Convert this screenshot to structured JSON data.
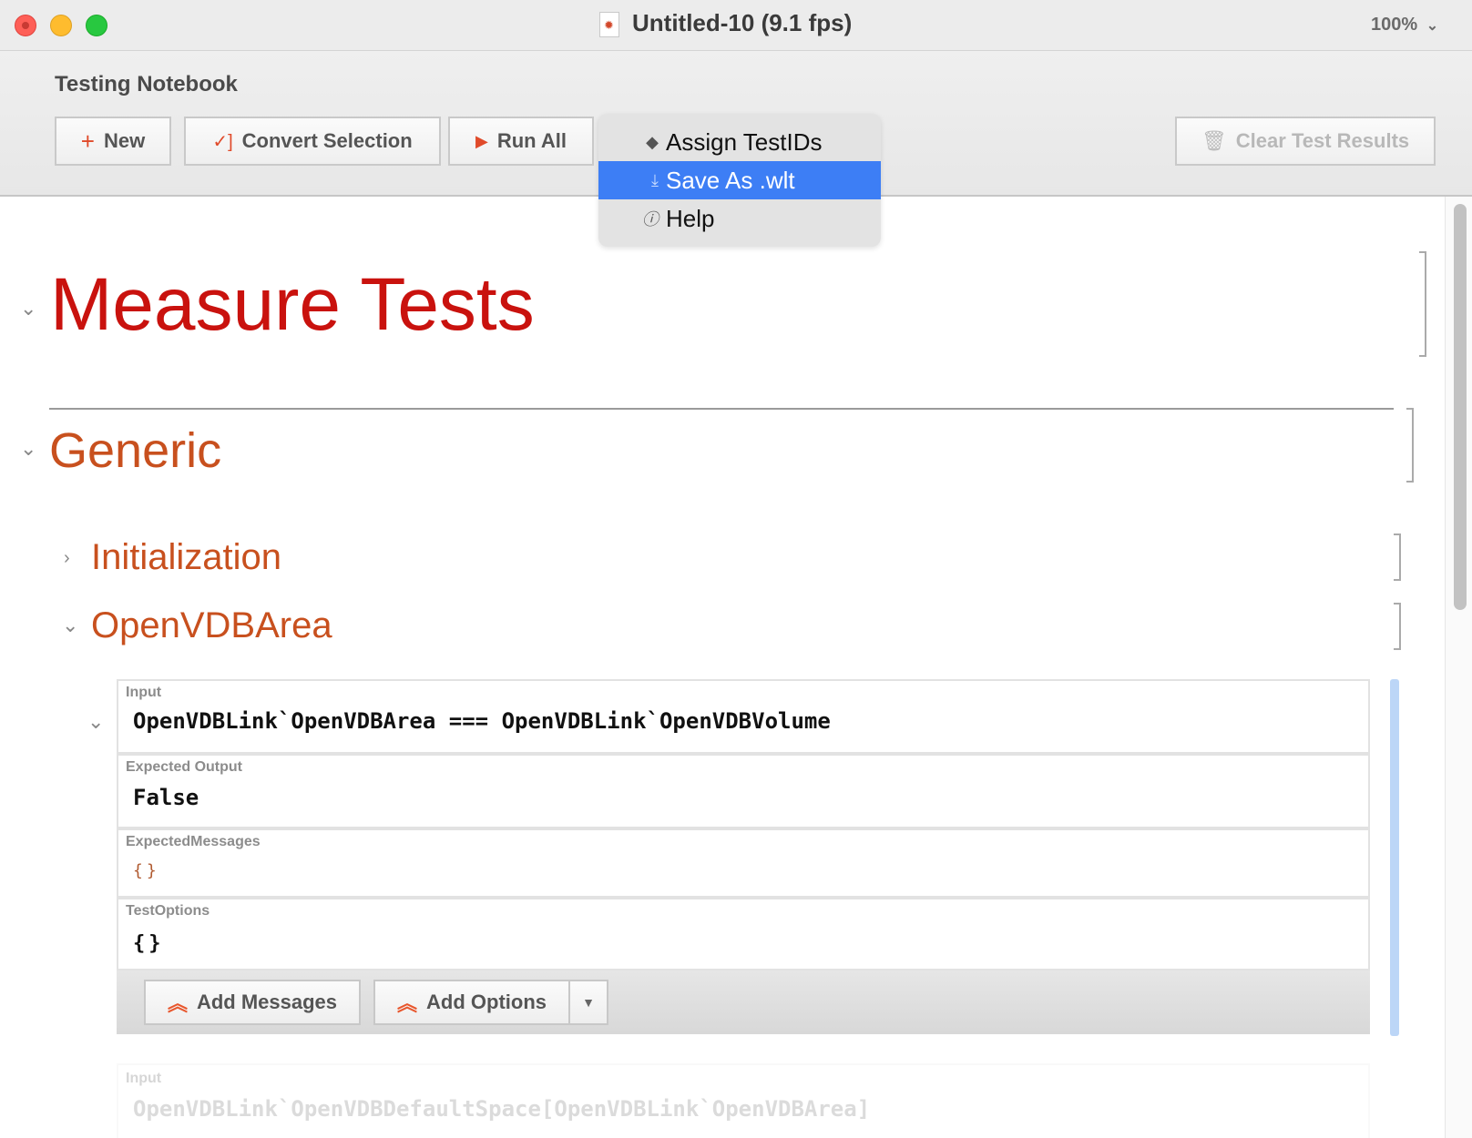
{
  "window": {
    "title": "Untitled-10 (9.1 fps)",
    "zoom": "100%"
  },
  "toolbar": {
    "title": "Testing Notebook",
    "buttons": {
      "new": "New",
      "convert": "Convert Selection",
      "run_all": "Run All",
      "clear": "Clear Test Results"
    }
  },
  "menu": {
    "items": [
      {
        "label": "Assign TestIDs",
        "icon": "tag-icon",
        "highlighted": false
      },
      {
        "label": "Save As .wlt",
        "icon": "download-icon",
        "highlighted": true
      },
      {
        "label": "Help",
        "icon": "info-icon",
        "highlighted": false
      }
    ]
  },
  "notebook": {
    "title": "Measure Tests",
    "section": "Generic",
    "subsections": [
      "Initialization",
      "OpenVDBArea"
    ]
  },
  "test": {
    "input_label": "Input",
    "input_code": "OpenVDBLink`OpenVDBArea === OpenVDBLink`OpenVDBVolume",
    "expected_output_label": "Expected Output",
    "expected_output": "False",
    "expected_messages_label": "ExpectedMessages",
    "expected_messages": "{}",
    "test_options_label": "TestOptions",
    "test_options": "{}",
    "add_messages": "Add Messages",
    "add_options": "Add Options"
  },
  "next_test": {
    "input_label": "Input",
    "input_code": "OpenVDBLink`OpenVDBDefaultSpace[OpenVDBLink`OpenVDBArea]"
  },
  "colors": {
    "title_red": "#c9120e",
    "section_orange": "#c8501e",
    "menu_highlight": "#3d7ef5"
  }
}
